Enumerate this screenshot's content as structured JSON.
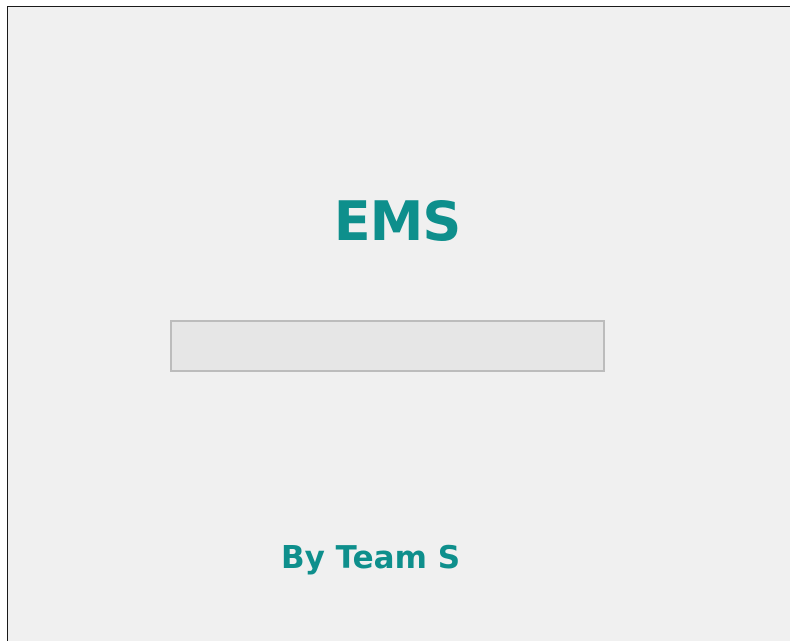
{
  "app": {
    "title": "EMS",
    "credit": "By Team S"
  },
  "progress": {
    "value": 0
  },
  "colors": {
    "accent": "#0e8f8c",
    "background": "#f0f0f0",
    "progress_track": "#e6e6e6",
    "progress_border": "#bcbcbc"
  }
}
